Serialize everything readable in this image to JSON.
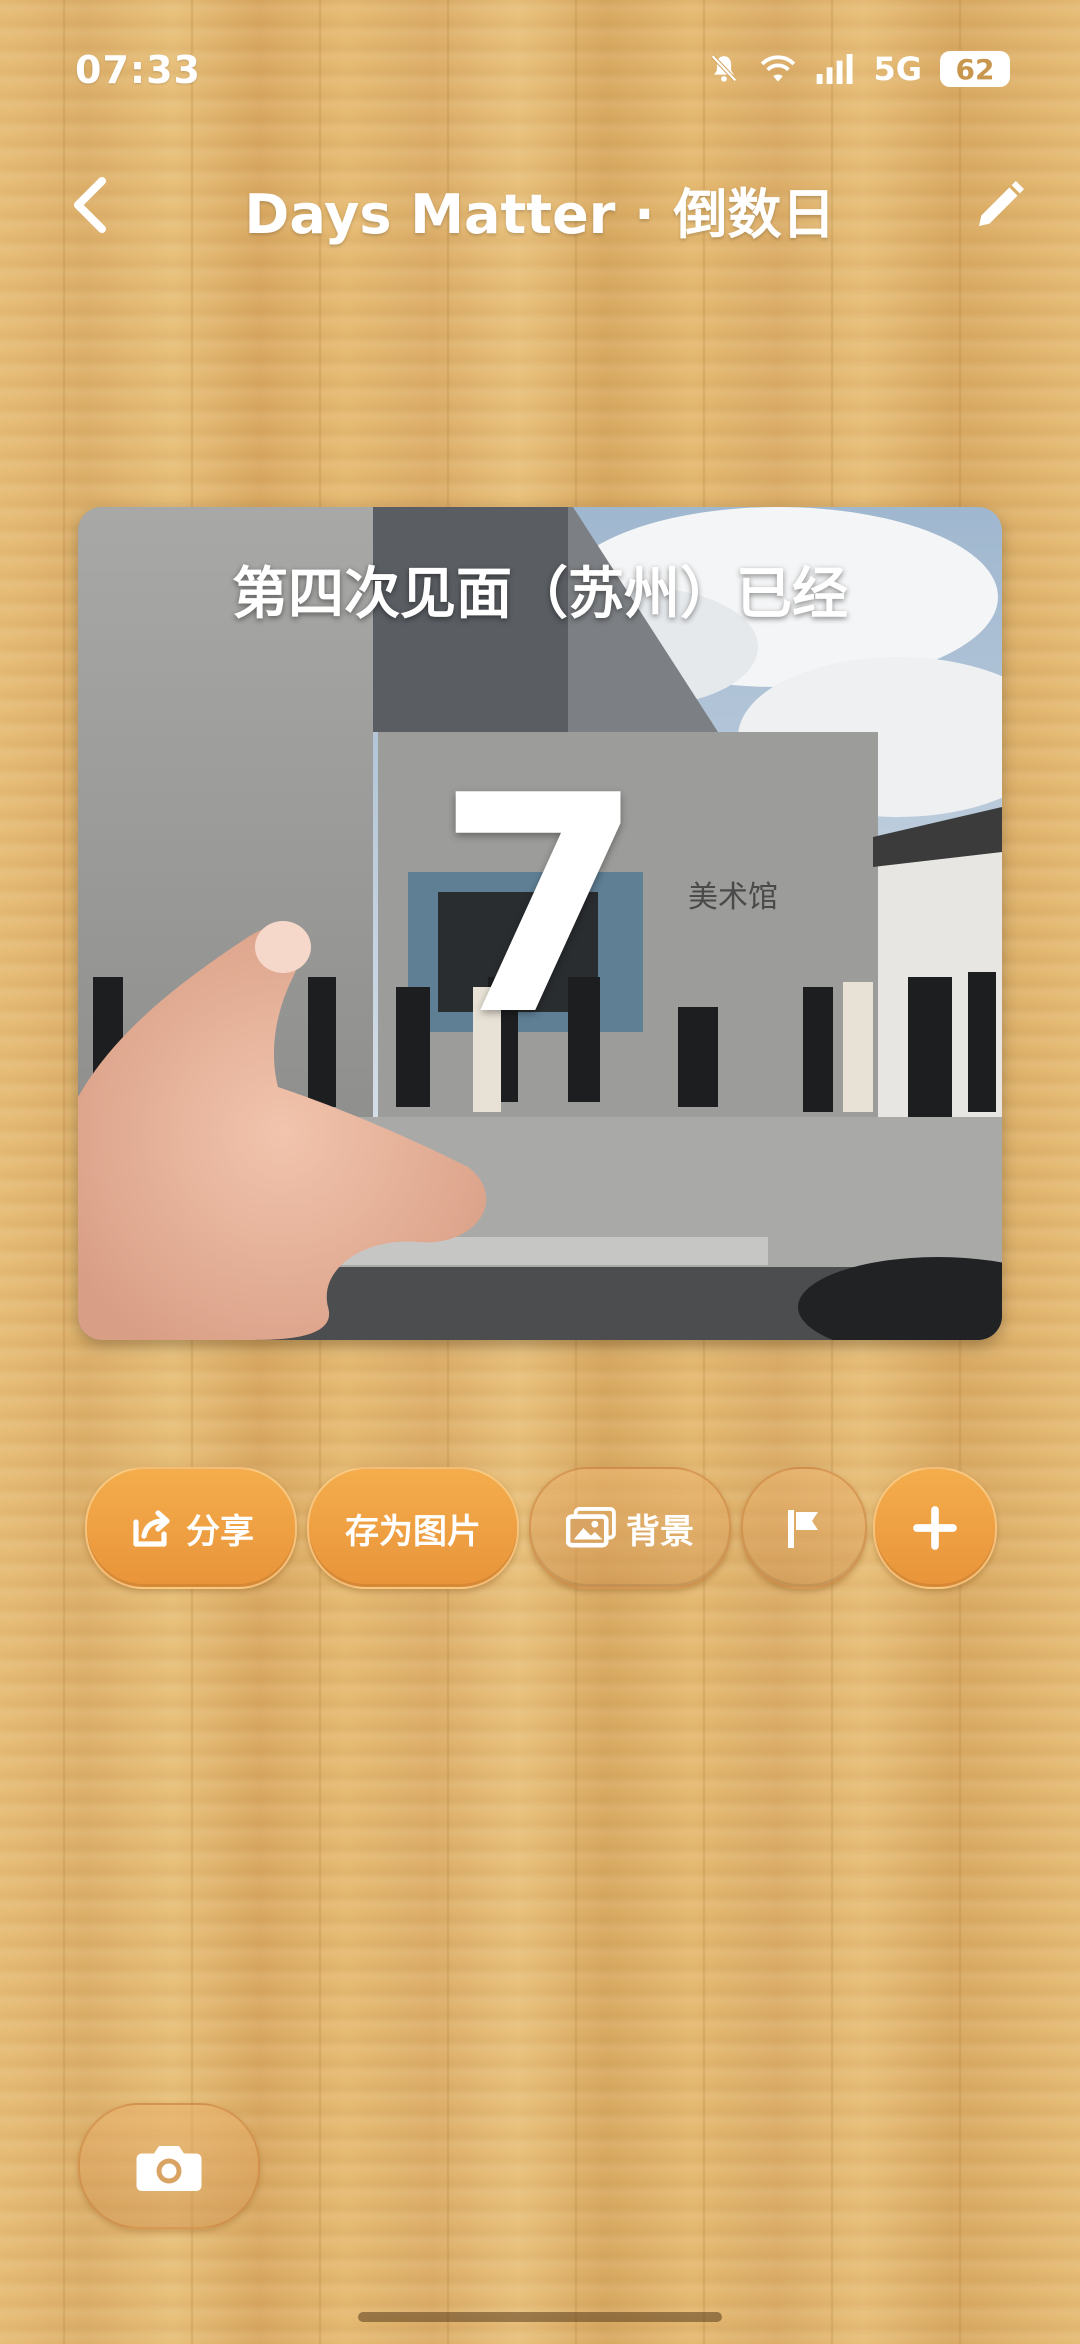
{
  "status_bar": {
    "time": "07:33",
    "network": "5G",
    "battery": "62",
    "icons": [
      "mute-bell-icon",
      "wifi-icon",
      "signal-icon"
    ]
  },
  "header": {
    "title": "Days Matter · 倒数日",
    "back_icon": "chevron-left-icon",
    "edit_icon": "pencil-icon"
  },
  "event": {
    "title": "第四次见面（苏州）已经",
    "days": "7",
    "photo": "street-scene-with-art-museum-and-film-crew"
  },
  "actions": {
    "share_label": "分享",
    "save_image_label": "存为图片",
    "background_label": "背景",
    "flag_icon": "flag-icon",
    "add_icon": "plus-icon"
  },
  "camera": {
    "icon": "camera-icon"
  },
  "colors": {
    "wood": "#e3b76f",
    "accent_orange": "#ef9f42",
    "text": "#ffffff"
  }
}
